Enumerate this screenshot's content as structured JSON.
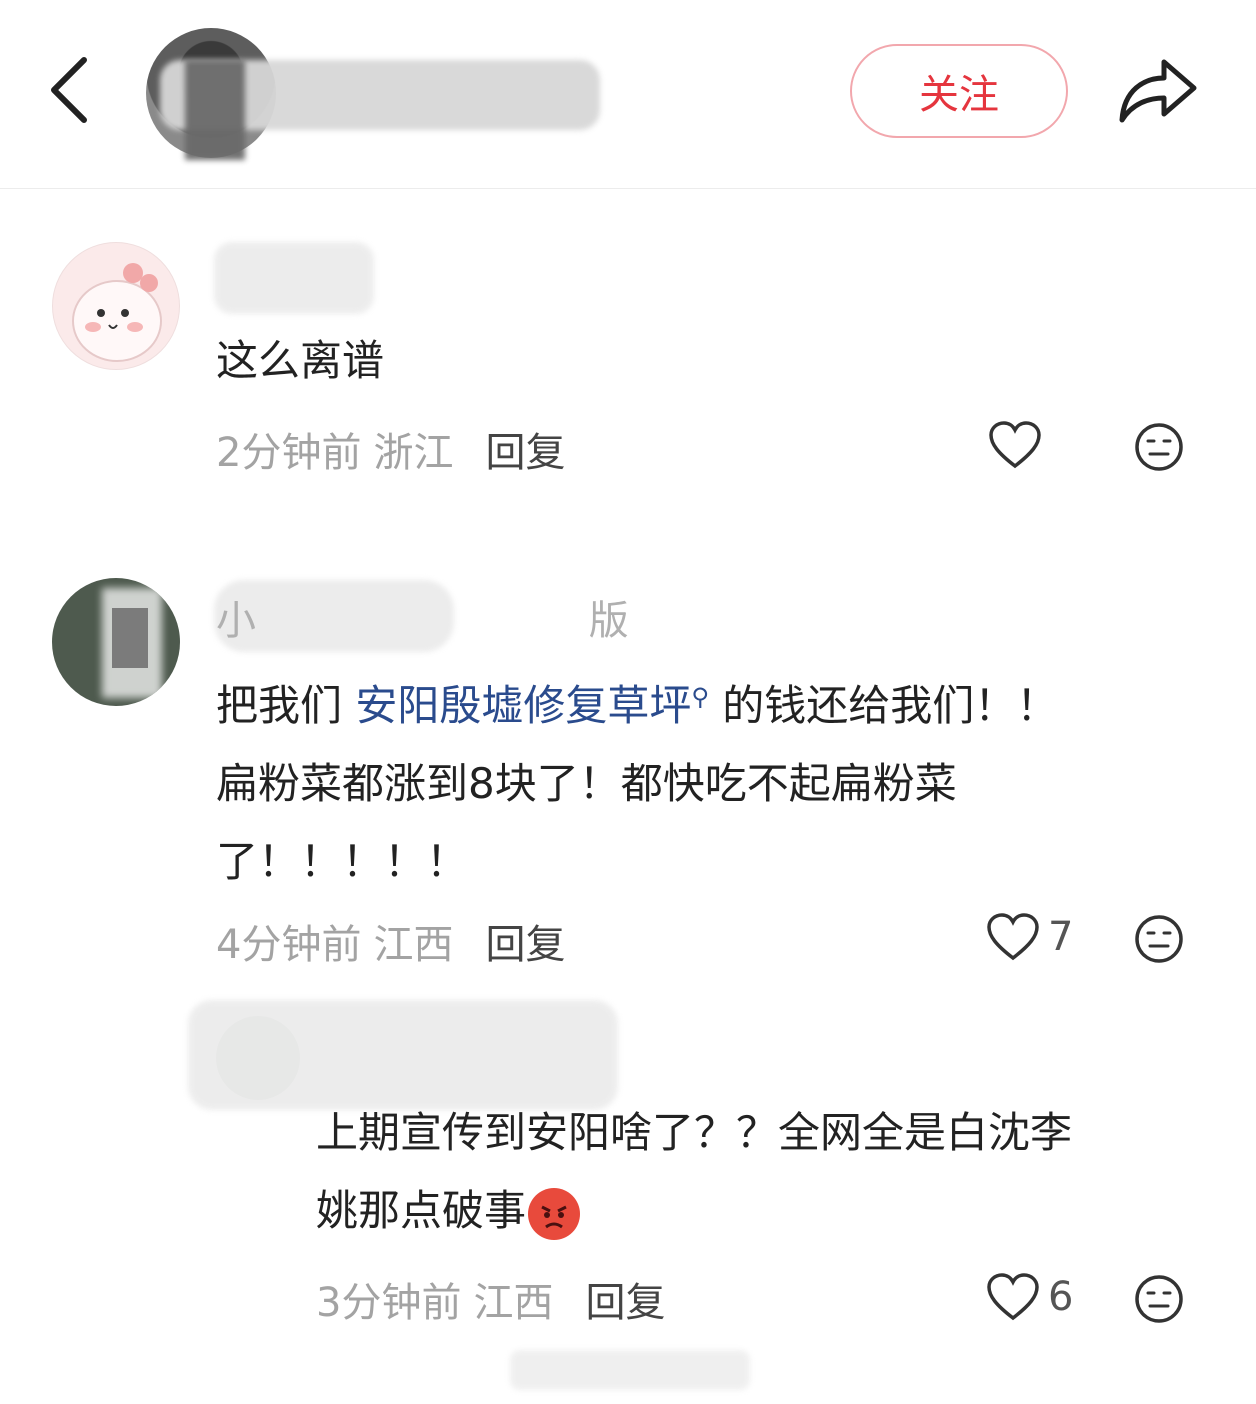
{
  "header": {
    "follow_label": "关注"
  },
  "comments": [
    {
      "text": "这么离谱",
      "time": "2分钟前",
      "region": "浙江",
      "reply_label": "回复",
      "likes": ""
    },
    {
      "username_visible": "小 版",
      "text_before_link": "把我们 ",
      "link_text": "安阳殷墟修复草坪",
      "text_after_link": " 的钱还给我们！！",
      "text_line2": "扁粉菜都涨到8块了！都快吃不起扁粉菜",
      "text_line3": "了！！！！！",
      "time": "4分钟前",
      "region": "江西",
      "reply_label": "回复",
      "likes": "7"
    },
    {
      "text_line1": "上期宣传到安阳啥了？？全网全是白沈李",
      "text_line2": "姚那点破事",
      "time": "3分钟前",
      "region": "江西",
      "reply_label": "回复",
      "likes": "6"
    }
  ],
  "icons": {
    "back": "chevron-left-icon",
    "share": "share-arrow-icon",
    "like": "heart-outline-icon",
    "dislike": "neutral-face-icon",
    "search": "search-icon",
    "emoji": "angry-face-emoji"
  },
  "colors": {
    "follow": "#e5353e",
    "link": "#2a4b8d"
  }
}
